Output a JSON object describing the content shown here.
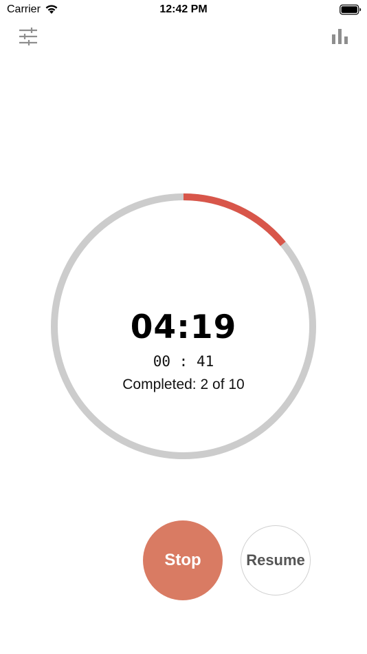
{
  "status_bar": {
    "carrier": "Carrier",
    "time": "12:42 PM",
    "icons": [
      "wifi-icon",
      "battery-icon"
    ]
  },
  "toolbar": {
    "settings_icon": "sliders-icon",
    "stats_icon": "bar-chart-icon"
  },
  "timer": {
    "main_time": "04:19",
    "sub_minutes": "00",
    "sub_separator": ":",
    "sub_seconds": "41",
    "completed_label": "Completed:",
    "completed_count": "2",
    "completed_of": "of",
    "completed_total": "10",
    "progress_fraction": 0.14
  },
  "controls": {
    "stop_label": "Stop",
    "resume_label": "Resume"
  },
  "colors": {
    "progress": "#d8564a",
    "track": "#cccccc",
    "stop_button": "#d97b63",
    "resume_text": "#555555",
    "icon_gray": "#8e8e8e"
  }
}
